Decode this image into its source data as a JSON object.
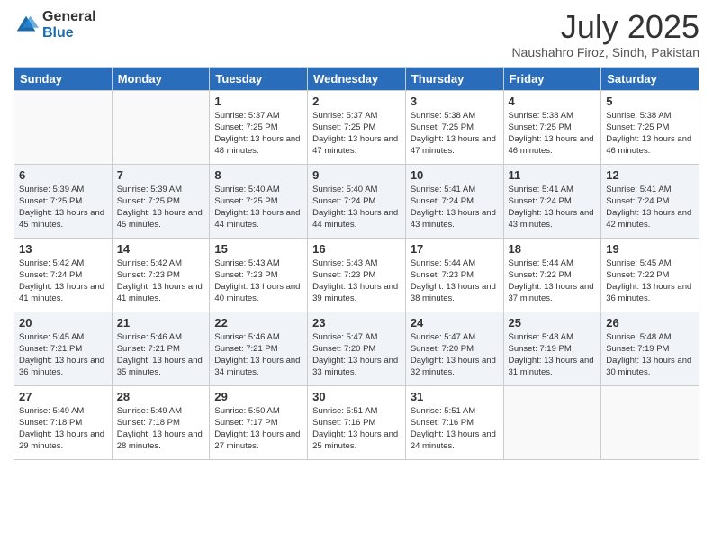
{
  "logo": {
    "general": "General",
    "blue": "Blue"
  },
  "title": "July 2025",
  "location": "Naushahro Firoz, Sindh, Pakistan",
  "days_of_week": [
    "Sunday",
    "Monday",
    "Tuesday",
    "Wednesday",
    "Thursday",
    "Friday",
    "Saturday"
  ],
  "weeks": [
    [
      {
        "day": "",
        "sunrise": "",
        "sunset": "",
        "daylight": ""
      },
      {
        "day": "",
        "sunrise": "",
        "sunset": "",
        "daylight": ""
      },
      {
        "day": "1",
        "sunrise": "Sunrise: 5:37 AM",
        "sunset": "Sunset: 7:25 PM",
        "daylight": "Daylight: 13 hours and 48 minutes."
      },
      {
        "day": "2",
        "sunrise": "Sunrise: 5:37 AM",
        "sunset": "Sunset: 7:25 PM",
        "daylight": "Daylight: 13 hours and 47 minutes."
      },
      {
        "day": "3",
        "sunrise": "Sunrise: 5:38 AM",
        "sunset": "Sunset: 7:25 PM",
        "daylight": "Daylight: 13 hours and 47 minutes."
      },
      {
        "day": "4",
        "sunrise": "Sunrise: 5:38 AM",
        "sunset": "Sunset: 7:25 PM",
        "daylight": "Daylight: 13 hours and 46 minutes."
      },
      {
        "day": "5",
        "sunrise": "Sunrise: 5:38 AM",
        "sunset": "Sunset: 7:25 PM",
        "daylight": "Daylight: 13 hours and 46 minutes."
      }
    ],
    [
      {
        "day": "6",
        "sunrise": "Sunrise: 5:39 AM",
        "sunset": "Sunset: 7:25 PM",
        "daylight": "Daylight: 13 hours and 45 minutes."
      },
      {
        "day": "7",
        "sunrise": "Sunrise: 5:39 AM",
        "sunset": "Sunset: 7:25 PM",
        "daylight": "Daylight: 13 hours and 45 minutes."
      },
      {
        "day": "8",
        "sunrise": "Sunrise: 5:40 AM",
        "sunset": "Sunset: 7:25 PM",
        "daylight": "Daylight: 13 hours and 44 minutes."
      },
      {
        "day": "9",
        "sunrise": "Sunrise: 5:40 AM",
        "sunset": "Sunset: 7:24 PM",
        "daylight": "Daylight: 13 hours and 44 minutes."
      },
      {
        "day": "10",
        "sunrise": "Sunrise: 5:41 AM",
        "sunset": "Sunset: 7:24 PM",
        "daylight": "Daylight: 13 hours and 43 minutes."
      },
      {
        "day": "11",
        "sunrise": "Sunrise: 5:41 AM",
        "sunset": "Sunset: 7:24 PM",
        "daylight": "Daylight: 13 hours and 43 minutes."
      },
      {
        "day": "12",
        "sunrise": "Sunrise: 5:41 AM",
        "sunset": "Sunset: 7:24 PM",
        "daylight": "Daylight: 13 hours and 42 minutes."
      }
    ],
    [
      {
        "day": "13",
        "sunrise": "Sunrise: 5:42 AM",
        "sunset": "Sunset: 7:24 PM",
        "daylight": "Daylight: 13 hours and 41 minutes."
      },
      {
        "day": "14",
        "sunrise": "Sunrise: 5:42 AM",
        "sunset": "Sunset: 7:23 PM",
        "daylight": "Daylight: 13 hours and 41 minutes."
      },
      {
        "day": "15",
        "sunrise": "Sunrise: 5:43 AM",
        "sunset": "Sunset: 7:23 PM",
        "daylight": "Daylight: 13 hours and 40 minutes."
      },
      {
        "day": "16",
        "sunrise": "Sunrise: 5:43 AM",
        "sunset": "Sunset: 7:23 PM",
        "daylight": "Daylight: 13 hours and 39 minutes."
      },
      {
        "day": "17",
        "sunrise": "Sunrise: 5:44 AM",
        "sunset": "Sunset: 7:23 PM",
        "daylight": "Daylight: 13 hours and 38 minutes."
      },
      {
        "day": "18",
        "sunrise": "Sunrise: 5:44 AM",
        "sunset": "Sunset: 7:22 PM",
        "daylight": "Daylight: 13 hours and 37 minutes."
      },
      {
        "day": "19",
        "sunrise": "Sunrise: 5:45 AM",
        "sunset": "Sunset: 7:22 PM",
        "daylight": "Daylight: 13 hours and 36 minutes."
      }
    ],
    [
      {
        "day": "20",
        "sunrise": "Sunrise: 5:45 AM",
        "sunset": "Sunset: 7:21 PM",
        "daylight": "Daylight: 13 hours and 36 minutes."
      },
      {
        "day": "21",
        "sunrise": "Sunrise: 5:46 AM",
        "sunset": "Sunset: 7:21 PM",
        "daylight": "Daylight: 13 hours and 35 minutes."
      },
      {
        "day": "22",
        "sunrise": "Sunrise: 5:46 AM",
        "sunset": "Sunset: 7:21 PM",
        "daylight": "Daylight: 13 hours and 34 minutes."
      },
      {
        "day": "23",
        "sunrise": "Sunrise: 5:47 AM",
        "sunset": "Sunset: 7:20 PM",
        "daylight": "Daylight: 13 hours and 33 minutes."
      },
      {
        "day": "24",
        "sunrise": "Sunrise: 5:47 AM",
        "sunset": "Sunset: 7:20 PM",
        "daylight": "Daylight: 13 hours and 32 minutes."
      },
      {
        "day": "25",
        "sunrise": "Sunrise: 5:48 AM",
        "sunset": "Sunset: 7:19 PM",
        "daylight": "Daylight: 13 hours and 31 minutes."
      },
      {
        "day": "26",
        "sunrise": "Sunrise: 5:48 AM",
        "sunset": "Sunset: 7:19 PM",
        "daylight": "Daylight: 13 hours and 30 minutes."
      }
    ],
    [
      {
        "day": "27",
        "sunrise": "Sunrise: 5:49 AM",
        "sunset": "Sunset: 7:18 PM",
        "daylight": "Daylight: 13 hours and 29 minutes."
      },
      {
        "day": "28",
        "sunrise": "Sunrise: 5:49 AM",
        "sunset": "Sunset: 7:18 PM",
        "daylight": "Daylight: 13 hours and 28 minutes."
      },
      {
        "day": "29",
        "sunrise": "Sunrise: 5:50 AM",
        "sunset": "Sunset: 7:17 PM",
        "daylight": "Daylight: 13 hours and 27 minutes."
      },
      {
        "day": "30",
        "sunrise": "Sunrise: 5:51 AM",
        "sunset": "Sunset: 7:16 PM",
        "daylight": "Daylight: 13 hours and 25 minutes."
      },
      {
        "day": "31",
        "sunrise": "Sunrise: 5:51 AM",
        "sunset": "Sunset: 7:16 PM",
        "daylight": "Daylight: 13 hours and 24 minutes."
      },
      {
        "day": "",
        "sunrise": "",
        "sunset": "",
        "daylight": ""
      },
      {
        "day": "",
        "sunrise": "",
        "sunset": "",
        "daylight": ""
      }
    ]
  ]
}
